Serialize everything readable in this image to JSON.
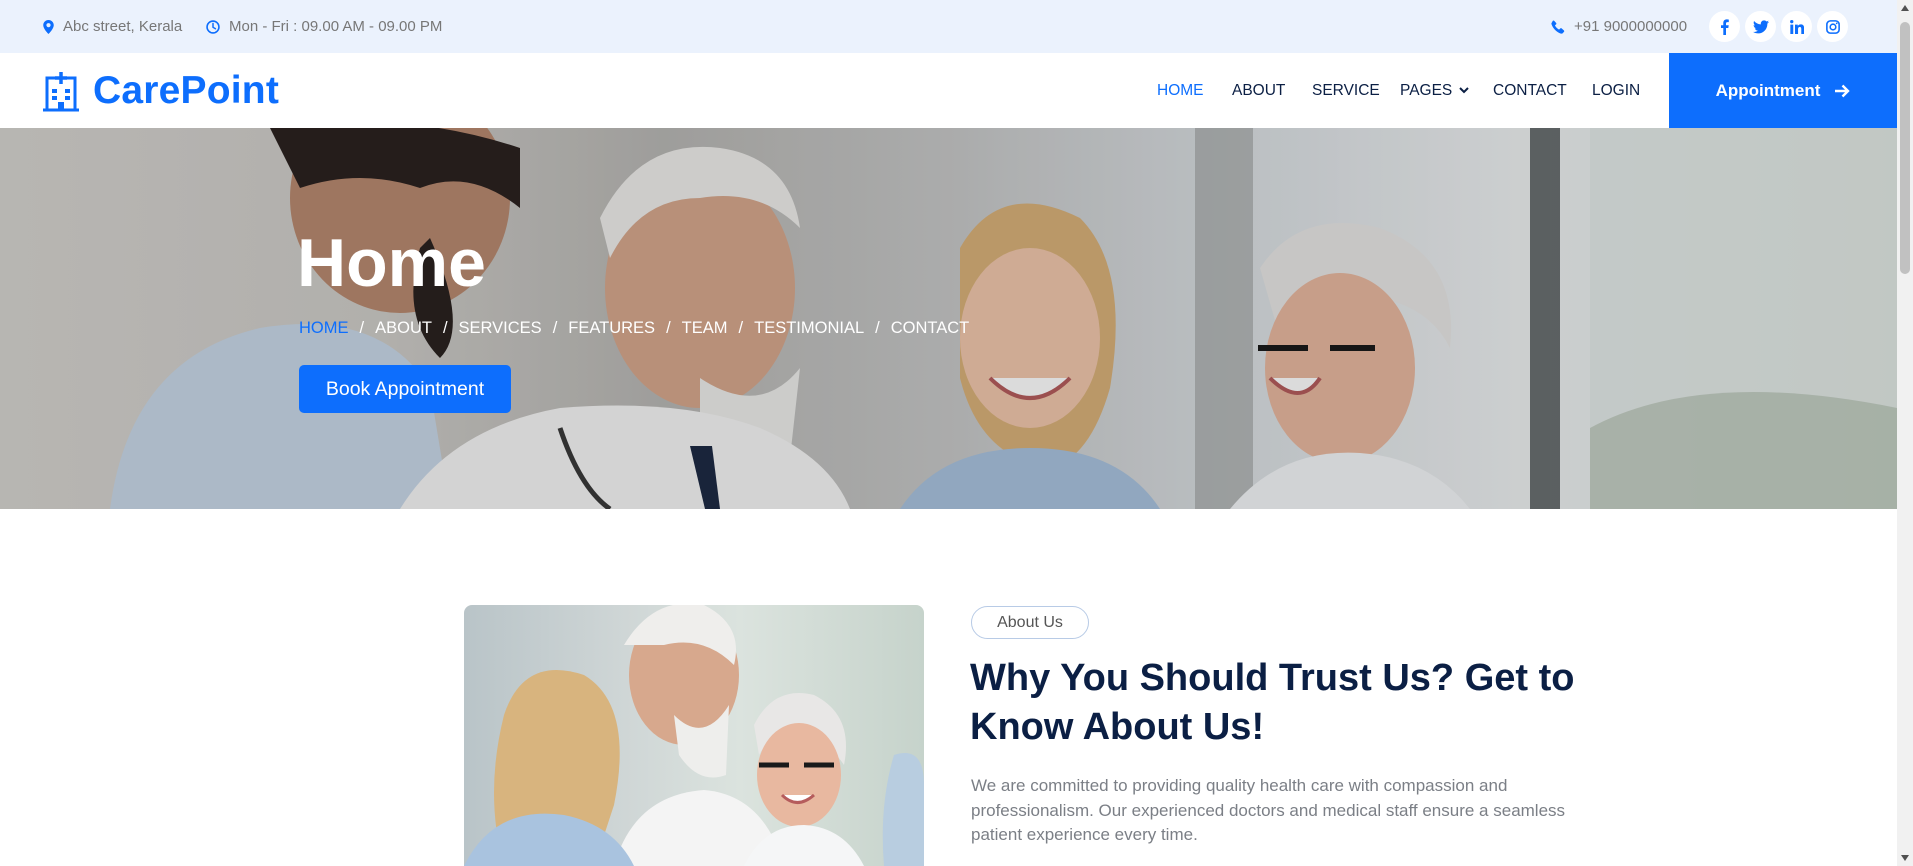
{
  "topbar": {
    "address": "Abc street, Kerala",
    "hours": "Mon - Fri : 09.00 AM - 09.00 PM",
    "phone": "+91 9000000000",
    "social_icons": [
      "facebook-icon",
      "twitter-icon",
      "linkedin-icon",
      "instagram-icon"
    ]
  },
  "brand": {
    "name": "CarePoint",
    "color": "#0d6efd"
  },
  "nav": {
    "items": [
      {
        "label": "HOME",
        "active": true
      },
      {
        "label": "ABOUT"
      },
      {
        "label": "SERVICE"
      },
      {
        "label": "PAGES",
        "dropdown": true
      },
      {
        "label": "CONTACT"
      },
      {
        "label": "LOGIN"
      }
    ],
    "cta_label": "Appointment"
  },
  "hero": {
    "title": "Home",
    "breadcrumbs": [
      "HOME",
      "ABOUT",
      "SERVICES",
      "FEATURES",
      "TEAM",
      "TESTIMONIAL",
      "CONTACT"
    ],
    "breadcrumb_separator": "/",
    "button_label": "Book Appointment"
  },
  "about": {
    "badge": "About Us",
    "title": "Why You Should Trust Us? Get to Know About Us!",
    "text": "We are committed to providing quality health care with compassion and professionalism. Our experienced doctors and medical staff ensure a seamless patient experience every time."
  }
}
